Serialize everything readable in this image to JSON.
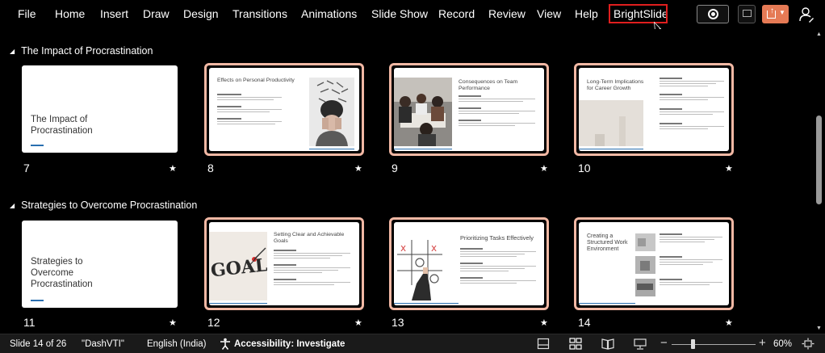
{
  "menu": {
    "items": [
      "File",
      "Home",
      "Insert",
      "Draw",
      "Design",
      "Transitions",
      "Animations",
      "Slide Show",
      "Record",
      "Review",
      "View",
      "Help",
      "BrightSlide"
    ]
  },
  "sections": [
    {
      "title": "The Impact of Procrastination"
    },
    {
      "title": "Strategies to Overcome Procrastination"
    }
  ],
  "slides": [
    {
      "number": "7",
      "title": "The Impact of Procrastination",
      "lines": [
        "The Impact of",
        "Procrastination"
      ]
    },
    {
      "number": "8",
      "title": "Effects on Personal Productivity"
    },
    {
      "number": "9",
      "title": "Consequences on Team Performance",
      "lines": [
        "Consequences on Team",
        "Performance"
      ]
    },
    {
      "number": "10",
      "title": "Long-Term Implications for Career Growth",
      "lines": [
        "Long-Term Implications",
        "for Career Growth"
      ]
    },
    {
      "number": "11",
      "title": "Strategies to Overcome Procrastination",
      "lines": [
        "Strategies to",
        "Overcome",
        "Procrastination"
      ]
    },
    {
      "number": "12",
      "title": "Setting Clear and Achievable Goals",
      "lines": [
        "Setting Clear and Achievable",
        "Goals"
      ]
    },
    {
      "number": "13",
      "title": "Prioritizing Tasks Effectively"
    },
    {
      "number": "14",
      "title": "Creating a Structured Work Environment",
      "lines": [
        "Creating a",
        "Structured Work",
        "Environment"
      ]
    }
  ],
  "status": {
    "slide_info": "Slide 14 of 26",
    "theme": "\"DashVTI\"",
    "language": "English (India)",
    "accessibility": "Accessibility: Investigate",
    "zoom": "60%",
    "zoom_level": 0.25
  },
  "icons": {
    "record": "record-icon",
    "comment": "comment-icon",
    "share": "share-icon",
    "coauthor": "coauthor-icon",
    "section_collapse": "collapse-triangle-icon",
    "star": "star-icon",
    "accessibility": "accessibility-icon",
    "notes": "notes-icon",
    "normal_view": "normal-view-icon",
    "slide_sorter": "slide-sorter-icon",
    "reading_view": "reading-view-icon",
    "slide_show": "slide-show-icon",
    "fit": "fit-to-window-icon"
  },
  "colors": {
    "selected_border": "#f2b8a4",
    "highlight_box": "#e01e1e",
    "share_button": "#e57a55",
    "accent_line": "#2a6fb0"
  }
}
